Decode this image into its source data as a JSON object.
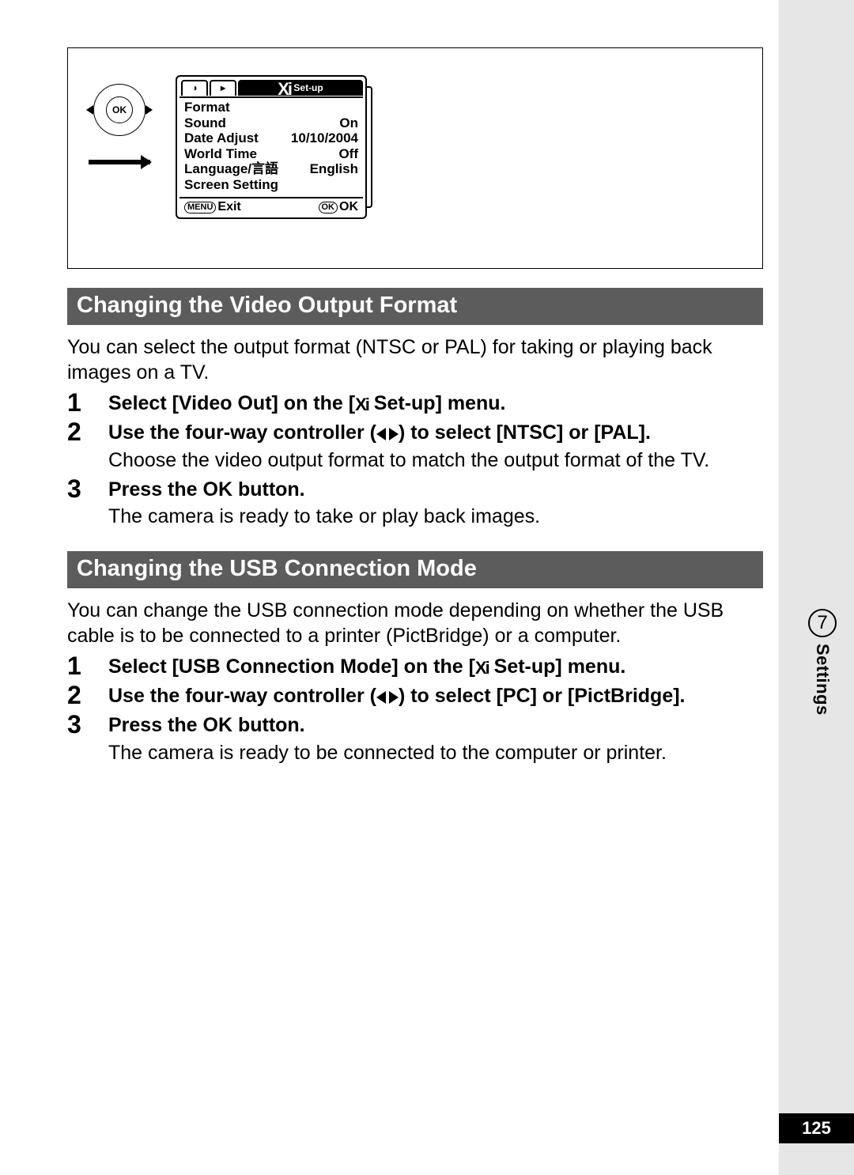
{
  "page_number": "125",
  "chapter": {
    "number": "7",
    "label": "Settings"
  },
  "lcd": {
    "tab_camera": "📷",
    "tab_play": "▸",
    "tab_setup": "Set-up",
    "rows": [
      {
        "label": "Format",
        "value": ""
      },
      {
        "label": "Sound",
        "value": "On"
      },
      {
        "label": "Date Adjust",
        "value": "10/10/2004"
      },
      {
        "label": "World Time",
        "value": "Off"
      },
      {
        "label": "Language/言語",
        "value": "English"
      },
      {
        "label": "Screen Setting",
        "value": ""
      }
    ],
    "footer_left_badge": "MENU",
    "footer_left": "Exit",
    "footer_right_badge": "OK",
    "footer_right": "OK"
  },
  "section1": {
    "title": "Changing the Video Output Format",
    "intro": "You can select the output format (NTSC or PAL) for taking or playing back images on a TV.",
    "steps": [
      {
        "title_a": "Select [Video Out] on the [",
        "title_b": " Set-up] menu."
      },
      {
        "title_a": "Use the four-way controller (",
        "title_b": ") to select [NTSC] or [PAL].",
        "body": "Choose the video output format to match the output format of the TV."
      },
      {
        "title_a": "Press the OK button.",
        "body": "The camera is ready to take or play back images."
      }
    ]
  },
  "section2": {
    "title": "Changing the USB Connection Mode",
    "intro": "You can change the USB connection mode depending on whether the USB cable is to be connected to a printer (PictBridge) or a computer.",
    "steps": [
      {
        "title_a": "Select [USB Connection Mode] on the [",
        "title_b": " Set-up] menu."
      },
      {
        "title_a": "Use the four-way controller (",
        "title_b": ") to select [PC] or [PictBridge]."
      },
      {
        "title_a": "Press the OK button.",
        "body": "The camera is ready to be connected to the computer or printer."
      }
    ]
  }
}
